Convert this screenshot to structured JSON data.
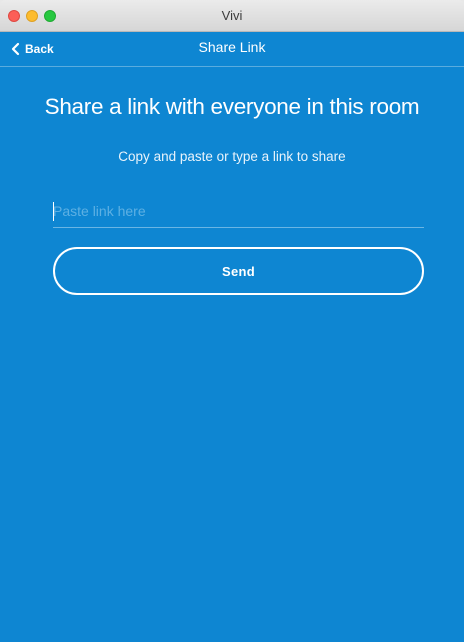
{
  "window": {
    "title": "Vivi",
    "controls": [
      "close",
      "minimize",
      "zoom"
    ]
  },
  "navbar": {
    "back_label": "Back",
    "back_icon": "chevron-left-icon",
    "title": "Share Link"
  },
  "main": {
    "heading": "Share a link with everyone in this room",
    "subheading": "Copy and paste or type a link to share",
    "link_input": {
      "value": "",
      "placeholder": "Paste link here"
    },
    "send_label": "Send"
  },
  "colors": {
    "background": "#0e86d2",
    "text": "#ffffff",
    "placeholder": "#5db0e3"
  }
}
